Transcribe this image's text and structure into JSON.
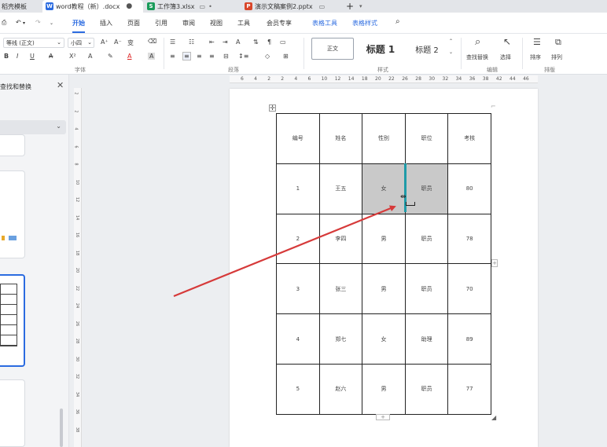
{
  "tabs": [
    {
      "label": "稻壳模板",
      "type": "none",
      "active": false
    },
    {
      "label": "word教程（新）.docx",
      "type": "W",
      "color": "#2b6be0",
      "active": true
    },
    {
      "label": "工作簿3.xlsx",
      "type": "S",
      "color": "#1a9b5a",
      "active": false
    },
    {
      "label": "演示文稿案例2.pptx",
      "type": "P",
      "color": "#d9472b",
      "active": false
    }
  ],
  "menu": {
    "items": [
      "开始",
      "插入",
      "页面",
      "引用",
      "审阅",
      "视图",
      "工具",
      "会员专享",
      "表格工具",
      "表格样式"
    ],
    "active": "开始"
  },
  "ribbon": {
    "font_name": "等线 (正文)",
    "font_size": "小四",
    "group_font": "字体",
    "group_paragraph": "段落",
    "group_styles": "样式",
    "group_edit": "编辑",
    "group_layout": "排版",
    "style_normal": "正文",
    "style_h1": "标题 1",
    "style_h2": "标题 2",
    "find_replace": "查找替换",
    "select": "选择",
    "sort": "排序",
    "arrange": "排列"
  },
  "panel": {
    "title": "查找和替换"
  },
  "ruler": {
    "h": [
      "6",
      "4",
      "2",
      "2",
      "4",
      "6",
      "10",
      "12",
      "14",
      "18",
      "20",
      "22",
      "26",
      "28",
      "30",
      "32",
      "34",
      "36",
      "38",
      "42",
      "44",
      "46"
    ],
    "v": [
      "2",
      "2",
      "4",
      "6",
      "8",
      "10",
      "12",
      "14",
      "16",
      "18",
      "20",
      "22",
      "24",
      "26",
      "28",
      "30",
      "32",
      "34",
      "36",
      "38"
    ]
  },
  "table": {
    "headers": [
      "编号",
      "姓名",
      "性别",
      "职位",
      "考核"
    ],
    "rows": [
      [
        "1",
        "王五",
        "女",
        "职员",
        "80"
      ],
      [
        "2",
        "李四",
        "男",
        "职员",
        "78"
      ],
      [
        "3",
        "张三",
        "男",
        "职员",
        "70"
      ],
      [
        "4",
        "郑七",
        "女",
        "助理",
        "89"
      ],
      [
        "5",
        "赵六",
        "男",
        "职员",
        "77"
      ]
    ]
  },
  "colors": {
    "accent": "#2b6be0",
    "arrow": "#d63a3a",
    "cursor_line": "#1f9ba8",
    "shade": "#c9c9c9"
  }
}
